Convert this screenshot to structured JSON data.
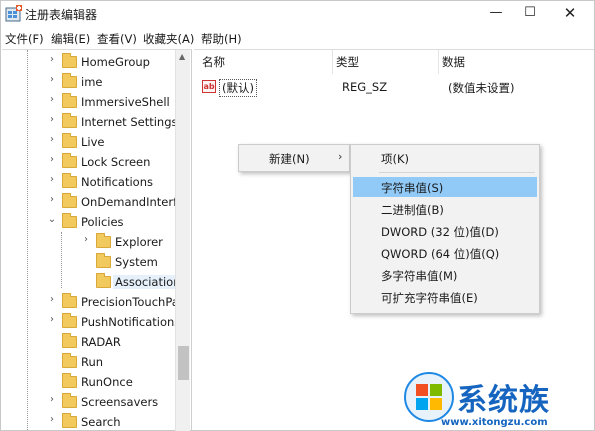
{
  "window": {
    "title": "注册表编辑器",
    "minimize": "—",
    "maximize": "☐",
    "close": "✕"
  },
  "menubar": [
    "文件(F)",
    "编辑(E)",
    "查看(V)",
    "收藏夹(A)",
    "帮助(H)"
  ],
  "tree": {
    "items": [
      {
        "label": "HomeGroup",
        "arrow": "›",
        "level": 1
      },
      {
        "label": "ime",
        "arrow": "›",
        "level": 1
      },
      {
        "label": "ImmersiveShell",
        "arrow": "›",
        "level": 1
      },
      {
        "label": "Internet Settings",
        "arrow": "›",
        "level": 1
      },
      {
        "label": "Live",
        "arrow": "›",
        "level": 1
      },
      {
        "label": "Lock Screen",
        "arrow": "›",
        "level": 1
      },
      {
        "label": "Notifications",
        "arrow": "›",
        "level": 1
      },
      {
        "label": "OnDemandInterfac",
        "arrow": "›",
        "level": 1
      },
      {
        "label": "Policies",
        "arrow": "⌄",
        "level": 1
      },
      {
        "label": "Explorer",
        "arrow": "›",
        "level": 2
      },
      {
        "label": "System",
        "arrow": "",
        "level": 2
      },
      {
        "label": "Associations",
        "arrow": "",
        "level": 2,
        "selected": true
      },
      {
        "label": "PrecisionTouchPac",
        "arrow": "›",
        "level": 1
      },
      {
        "label": "PushNotifications",
        "arrow": "›",
        "level": 1
      },
      {
        "label": "RADAR",
        "arrow": "",
        "level": 1
      },
      {
        "label": "Run",
        "arrow": "",
        "level": 1
      },
      {
        "label": "RunOnce",
        "arrow": "",
        "level": 1
      },
      {
        "label": "Screensavers",
        "arrow": "›",
        "level": 1
      },
      {
        "label": "Search",
        "arrow": "›",
        "level": 1
      }
    ]
  },
  "list": {
    "columns": {
      "name": "名称",
      "type": "类型",
      "data": "数据"
    },
    "rows": [
      {
        "icon": "ab",
        "name": "(默认)",
        "type": "REG_SZ",
        "data": "(数值未设置)"
      }
    ]
  },
  "context_menu": {
    "parent_label": "新建(N)",
    "parent_arrow": "›",
    "submenu": [
      {
        "label": "项(K)"
      },
      {
        "label": "字符串值(S)",
        "highlight": true
      },
      {
        "label": "二进制值(B)"
      },
      {
        "label": "DWORD (32 位)值(D)"
      },
      {
        "label": "QWORD (64 位)值(Q)"
      },
      {
        "label": "多字符串值(M)"
      },
      {
        "label": "可扩充字符串值(E)"
      }
    ]
  },
  "watermark": {
    "text": "系统族",
    "url": "www.xitongzu.com"
  }
}
